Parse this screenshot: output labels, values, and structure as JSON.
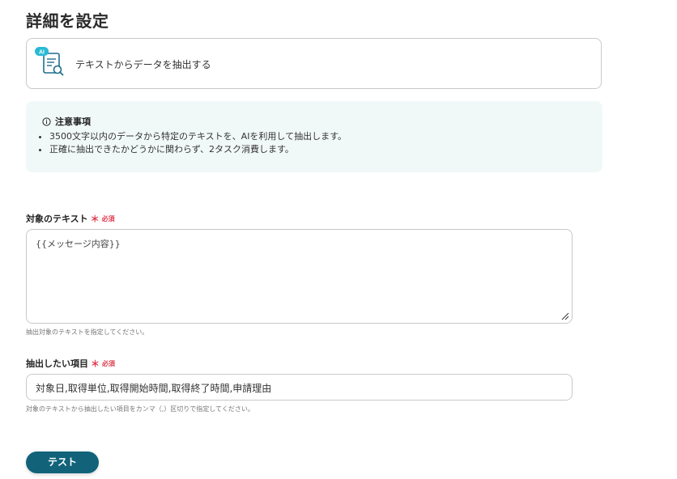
{
  "page": {
    "title": "詳細を設定"
  },
  "action": {
    "badge": "AI",
    "label": "テキストからデータを抽出する",
    "icon": "ai-document-search-icon"
  },
  "notice": {
    "title": "注意事項",
    "items": [
      "3500文字以内のデータから特定のテキストを、AIを利用して抽出します。",
      "正確に抽出できたかどうかに関わらず、2タスク消費します。"
    ]
  },
  "target_text": {
    "label": "対象のテキスト",
    "required_mark": "＊",
    "required": "必須",
    "value": "{{メッセージ内容}}",
    "hint": "抽出対象のテキストを指定してください。"
  },
  "extract_items": {
    "label": "抽出したい項目",
    "required_mark": "＊",
    "required": "必須",
    "value": "対象日,取得単位,取得開始時間,取得終了時間,申請理由",
    "hint": "対象のテキストから抽出したい項目をカンマ（,）区切りで指定してください。"
  },
  "buttons": {
    "test": "テスト"
  },
  "colors": {
    "primary": "#12637a",
    "required": "#e0394c",
    "notice_bg": "#f1f9f8",
    "ai_badge": "#28b9d3"
  }
}
